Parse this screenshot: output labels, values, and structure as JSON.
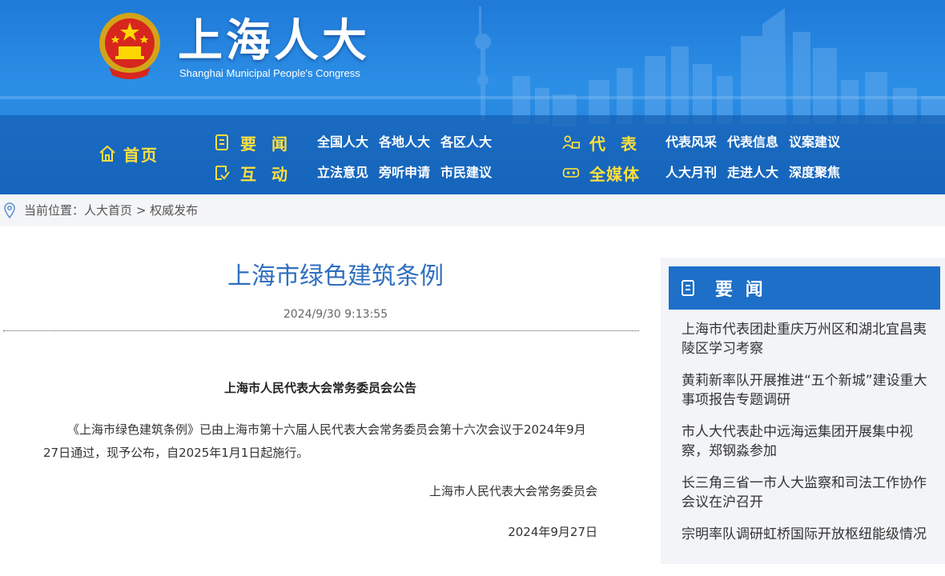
{
  "header": {
    "site_title": "上海人大",
    "site_subtitle": "Shanghai Municipal People's Congress",
    "home_label": "首页",
    "nav": {
      "yaowen": {
        "title": "要 闻",
        "links": [
          "全国人大",
          "各地人大",
          "各区人大"
        ]
      },
      "hudong": {
        "title": "互 动",
        "links": [
          "立法意见",
          "旁听申请",
          "市民建议"
        ]
      },
      "daibiao": {
        "title": "代 表",
        "links": [
          "代表风采",
          "代表信息",
          "议案建议"
        ]
      },
      "quanmeiti": {
        "title": "全媒体",
        "links": [
          "人大月刊",
          "走进人大",
          "深度聚焦"
        ]
      }
    }
  },
  "breadcrumb": {
    "prefix": "当前位置：",
    "items": [
      "人大首页",
      "权威发布"
    ],
    "separator": ">"
  },
  "article": {
    "title": "上海市绿色建筑条例",
    "datetime": "2024/9/30 9:13:55",
    "announcement_heading": "上海市人民代表大会常务委员会公告",
    "body": "《上海市绿色建筑条例》已由上海市第十六届人民代表大会常务委员会第十六次会议于2024年9月27日通过，现予公布，自2025年1月1日起施行。",
    "signature": "上海市人民代表大会常务委员会",
    "sign_date": "2024年9月27日"
  },
  "sidebar": {
    "title": "要 闻",
    "items": [
      "上海市代表团赴重庆万州区和湖北宜昌夷陵区学习考察",
      "黄莉新率队开展推进“五个新城”建设重大事项报告专题调研",
      "市人大代表赴中远海运集团开展集中视察，郑钢淼参加",
      "长三角三省一市人大监察和司法工作协作会议在沪召开",
      "宗明率队调研虹桥国际开放枢纽能级情况"
    ]
  },
  "colors": {
    "header_blue": "#1f7ad8",
    "nav_yellow": "#ffdf3d",
    "title_blue": "#2f6fbf",
    "sidebar_blue": "#1d6fc7"
  }
}
